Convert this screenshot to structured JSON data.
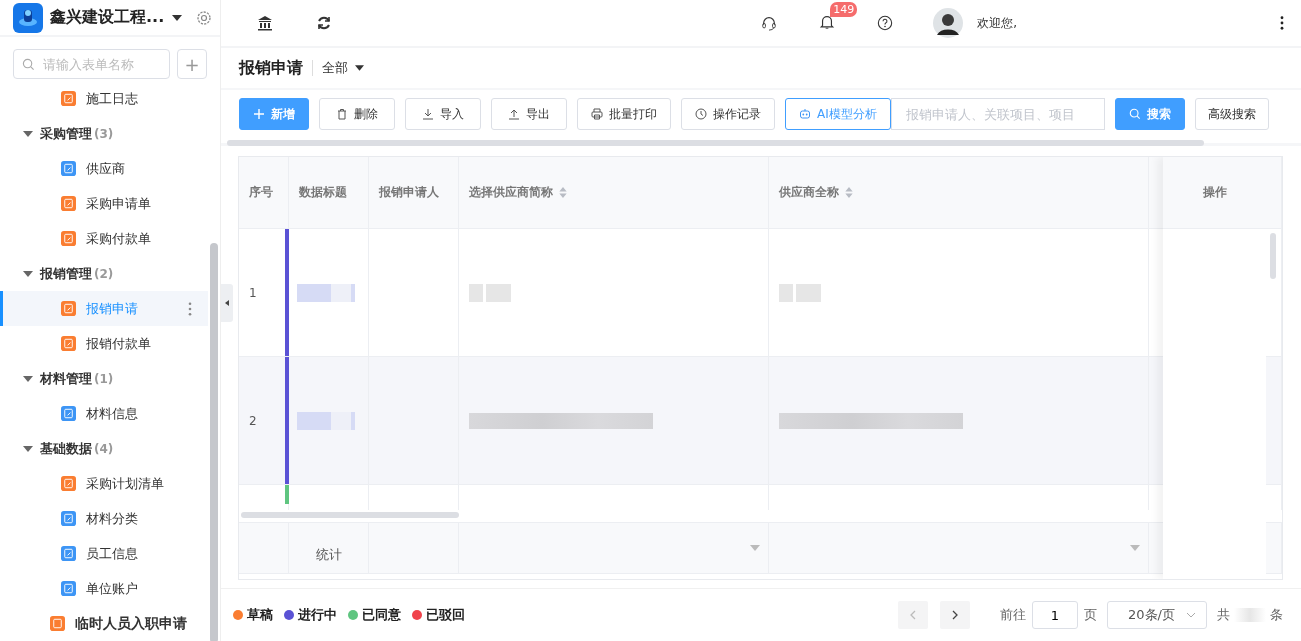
{
  "app": {
    "name": "鑫兴建设工程..."
  },
  "sidebar": {
    "search": {
      "placeholder": "请输入表单名称"
    },
    "add_label": "+",
    "tree": [
      {
        "kind": "continued",
        "children": [
          {
            "label": "施工日志",
            "color": "#fa7d31",
            "selected": false
          }
        ]
      },
      {
        "kind": "group",
        "label": "采购管理",
        "count": "(3)",
        "expanded": true,
        "children": [
          {
            "label": "供应商",
            "color": "#3d95f5",
            "selected": false
          },
          {
            "label": "采购申请单",
            "color": "#fa7d31",
            "selected": false
          },
          {
            "label": "采购付款单",
            "color": "#fa7d31",
            "selected": false
          }
        ]
      },
      {
        "kind": "group",
        "label": "报销管理",
        "count": "(2)",
        "expanded": true,
        "children": [
          {
            "label": "报销申请",
            "color": "#fa7d31",
            "selected": true
          },
          {
            "label": "报销付款单",
            "color": "#fa7d31",
            "selected": false
          }
        ]
      },
      {
        "kind": "group",
        "label": "材料管理",
        "count": "(1)",
        "expanded": true,
        "children": [
          {
            "label": "材料信息",
            "color": "#3d95f5",
            "selected": false
          }
        ]
      },
      {
        "kind": "group",
        "label": "基础数据",
        "count": "(4)",
        "expanded": true,
        "children": [
          {
            "label": "采购计划清单",
            "color": "#fa7d31",
            "selected": false
          },
          {
            "label": "材料分类",
            "color": "#3d95f5",
            "selected": false
          },
          {
            "label": "员工信息",
            "color": "#3d95f5",
            "selected": false
          },
          {
            "label": "单位账户",
            "color": "#3d95f5",
            "selected": false
          }
        ]
      },
      {
        "kind": "form",
        "label": "临时人员入职申请",
        "color": "#fa7d31",
        "selected": false
      }
    ]
  },
  "header": {
    "badge": "149",
    "greeting": "欢迎您,"
  },
  "page": {
    "title": "报销申请",
    "filter": "全部"
  },
  "toolbar": [
    {
      "kind": "primary",
      "label": "新增"
    },
    {
      "kind": "delete",
      "label": "删除"
    },
    {
      "kind": "import",
      "label": "导入"
    },
    {
      "kind": "export",
      "label": "导出"
    },
    {
      "kind": "print",
      "label": "批量打印"
    },
    {
      "kind": "log",
      "label": "操作记录"
    },
    {
      "kind": "ai",
      "label": "AI模型分析"
    }
  ],
  "search": {
    "placeholder": "报销申请人、关联项目、项目",
    "button": "搜索",
    "advanced": "高级搜索"
  },
  "table": {
    "columns": [
      {
        "label": "序号",
        "sortable": false
      },
      {
        "label": "数据标题",
        "sortable": false
      },
      {
        "label": "报销申请人",
        "sortable": false
      },
      {
        "label": "选择供应商简称",
        "sortable": true
      },
      {
        "label": "供应商全称",
        "sortable": true
      }
    ],
    "action_column": "操作",
    "rows": [
      {
        "number": "1",
        "color": "#5a52d5"
      },
      {
        "number": "2",
        "color": "#5a52d5"
      }
    ],
    "partial_row": {
      "color": "#5fc580"
    },
    "summary_label": "统计"
  },
  "legend": [
    {
      "label": "草稿",
      "color": "#fa7d31"
    },
    {
      "label": "进行中",
      "color": "#5a52d5"
    },
    {
      "label": "已同意",
      "color": "#5fc580"
    },
    {
      "label": "已驳回",
      "color": "#f0434b"
    }
  ],
  "pagination": {
    "goto": "前往",
    "page": "1",
    "page_unit": "页",
    "page_size": "20条/页",
    "total_prefix": "共",
    "total_suffix": "条"
  }
}
